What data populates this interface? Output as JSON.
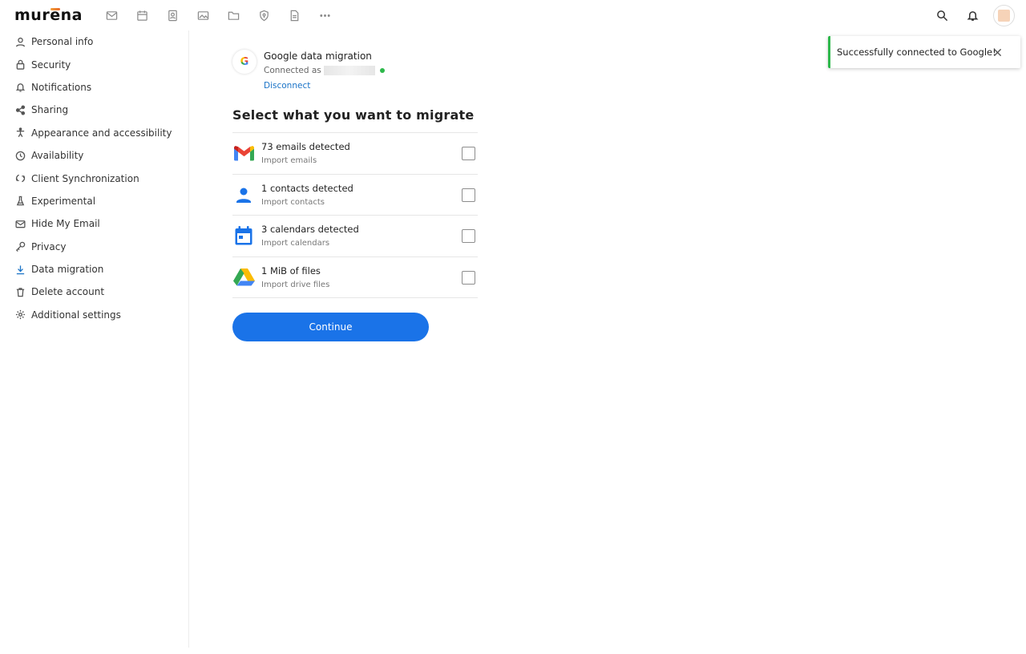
{
  "header": {
    "logo": "murena",
    "apps": [
      {
        "icon": "mail-icon",
        "name": "Mail"
      },
      {
        "icon": "calendar-icon",
        "name": "Calendar"
      },
      {
        "icon": "contacts-icon",
        "name": "Contacts"
      },
      {
        "icon": "photos-icon",
        "name": "Photos"
      },
      {
        "icon": "files-icon",
        "name": "Files"
      },
      {
        "icon": "passwords-icon",
        "name": "Passwords"
      },
      {
        "icon": "notes-icon",
        "name": "Notes"
      },
      {
        "icon": "more-icon",
        "name": "More apps"
      }
    ],
    "right_icons": [
      "search-icon",
      "bell-icon",
      "avatar"
    ]
  },
  "sidebar": {
    "items": [
      {
        "label": "Personal info",
        "icon": "person-icon"
      },
      {
        "label": "Security",
        "icon": "lock-icon"
      },
      {
        "label": "Notifications",
        "icon": "bell-icon"
      },
      {
        "label": "Sharing",
        "icon": "share-icon"
      },
      {
        "label": "Appearance and accessibility",
        "icon": "accessibility-icon"
      },
      {
        "label": "Availability",
        "icon": "clock-icon"
      },
      {
        "label": "Client Synchronization",
        "icon": "sync-icon"
      },
      {
        "label": "Experimental",
        "icon": "flask-icon"
      },
      {
        "label": "Hide My Email",
        "icon": "mail-icon"
      },
      {
        "label": "Privacy",
        "icon": "key-icon"
      },
      {
        "label": "Data migration",
        "icon": "download-icon",
        "active": true
      },
      {
        "label": "Delete account",
        "icon": "trash-icon"
      },
      {
        "label": "Additional settings",
        "icon": "gear-icon"
      }
    ]
  },
  "migration": {
    "logo_letter": "G",
    "title": "Google data migration",
    "connected_as": "Connected as",
    "disconnect": "Disconnect",
    "heading": "Select what you want to migrate",
    "items": [
      {
        "title": "73 emails detected",
        "subtitle": "Import emails",
        "icon": "gmail-icon",
        "checked": false
      },
      {
        "title": "1 contacts detected",
        "subtitle": "Import contacts",
        "icon": "contact-person-icon",
        "checked": false
      },
      {
        "title": "3 calendars detected",
        "subtitle": "Import calendars",
        "icon": "calendar-icon",
        "checked": false
      },
      {
        "title": "1 MiB of files",
        "subtitle": "Import drive files",
        "icon": "google-drive-icon",
        "checked": false
      }
    ],
    "continue": "Continue"
  },
  "toast": {
    "message": "Successfully connected to Google!"
  },
  "colors": {
    "accent": "#1a73e8",
    "link": "#1a73c7",
    "success": "#2db84b"
  }
}
